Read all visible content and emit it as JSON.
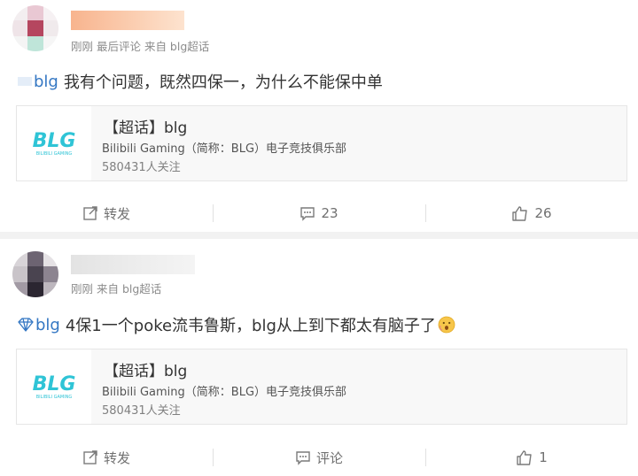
{
  "posts": [
    {
      "meta": "刚刚 最后评论 来自 blg超话",
      "topic": "blg",
      "text": "我有个问题，既然四保一，为什么不能保中单",
      "card": {
        "logo_text": "BLG",
        "logo_sub": "BILIBILI GAMING",
        "title": "【超话】blg",
        "desc": "Bilibili Gaming（简称：BLG）电子竞技俱乐部",
        "followers": "580431人关注"
      },
      "actions": {
        "repost": "转发",
        "comment": "23",
        "like": "26"
      }
    },
    {
      "meta": "刚刚 来自 blg超话",
      "topic": "blg",
      "text": "4保1一个poke流韦鲁斯，blg从上到下都太有脑子了",
      "card": {
        "logo_text": "BLG",
        "logo_sub": "BILIBILI GAMING",
        "title": "【超话】blg",
        "desc": "Bilibili Gaming（简称：BLG）电子竞技俱乐部",
        "followers": "580431人关注"
      },
      "actions": {
        "repost": "转发",
        "comment": "评论",
        "like": "1"
      }
    }
  ],
  "colors": {
    "link": "#3477c3",
    "logo": "#2fc4d6",
    "muted": "#8c8c8c"
  }
}
